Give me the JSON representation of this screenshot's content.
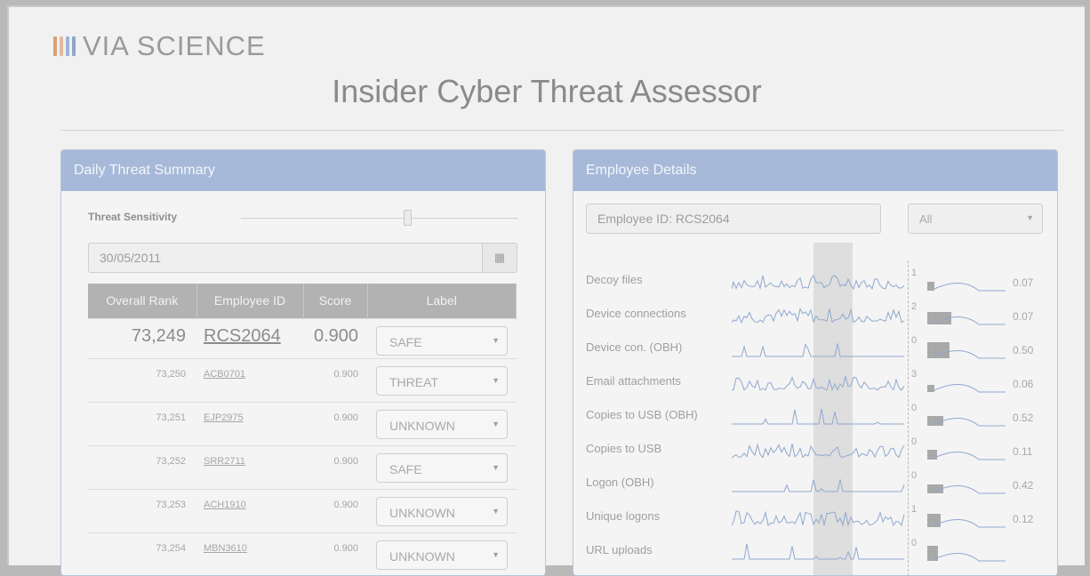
{
  "brand": {
    "name": "VIA SCIENCE",
    "bar_colors": [
      "#d9a07a",
      "#e2b9a0",
      "#9fb3d3",
      "#8ea6cc"
    ]
  },
  "app_title": "Insider Cyber Threat Assessor",
  "summary": {
    "header": "Daily Threat Summary",
    "sensitivity_label": "Threat Sensitivity",
    "sensitivity_value": 0.6,
    "date": "30/05/2011",
    "calendar_icon": "calendar-icon",
    "columns": [
      "Overall Rank",
      "Employee ID",
      "Score",
      "Label"
    ],
    "rows": [
      {
        "rank": "73,249",
        "employee": "RCS2064",
        "score": "0.900",
        "label": "SAFE"
      },
      {
        "rank": "73,250",
        "employee": "ACB0701",
        "score": "0.900",
        "label": "THREAT"
      },
      {
        "rank": "73,251",
        "employee": "EJP2975",
        "score": "0.900",
        "label": "UNKNOWN"
      },
      {
        "rank": "73,252",
        "employee": "SRR2711",
        "score": "0.900",
        "label": "SAFE"
      },
      {
        "rank": "73,253",
        "employee": "ACH1910",
        "score": "0.900",
        "label": "UNKNOWN"
      },
      {
        "rank": "73,254",
        "employee": "MBN3610",
        "score": "0.900",
        "label": "UNKNOWN"
      }
    ]
  },
  "details": {
    "header": "Employee Details",
    "employee_field": "Employee ID: RCS2064",
    "filter_value": "All",
    "metrics": [
      {
        "label": "Decoy files",
        "count": "1",
        "value": "0.07"
      },
      {
        "label": "Device connections",
        "count": "2",
        "value": "0.07"
      },
      {
        "label": "Device con. (OBH)",
        "count": "0",
        "value": "0.50"
      },
      {
        "label": "Email attachments",
        "count": "3",
        "value": "0.06"
      },
      {
        "label": "Copies to USB (OBH)",
        "count": "0",
        "value": "0.52"
      },
      {
        "label": "Copies to USB",
        "count": "0",
        "value": "0.11"
      },
      {
        "label": "Logon (OBH)",
        "count": "0",
        "value": "0.42"
      },
      {
        "label": "Unique logons",
        "count": "1",
        "value": "0.12"
      },
      {
        "label": "URL uploads",
        "count": "0",
        "value": ""
      }
    ]
  }
}
